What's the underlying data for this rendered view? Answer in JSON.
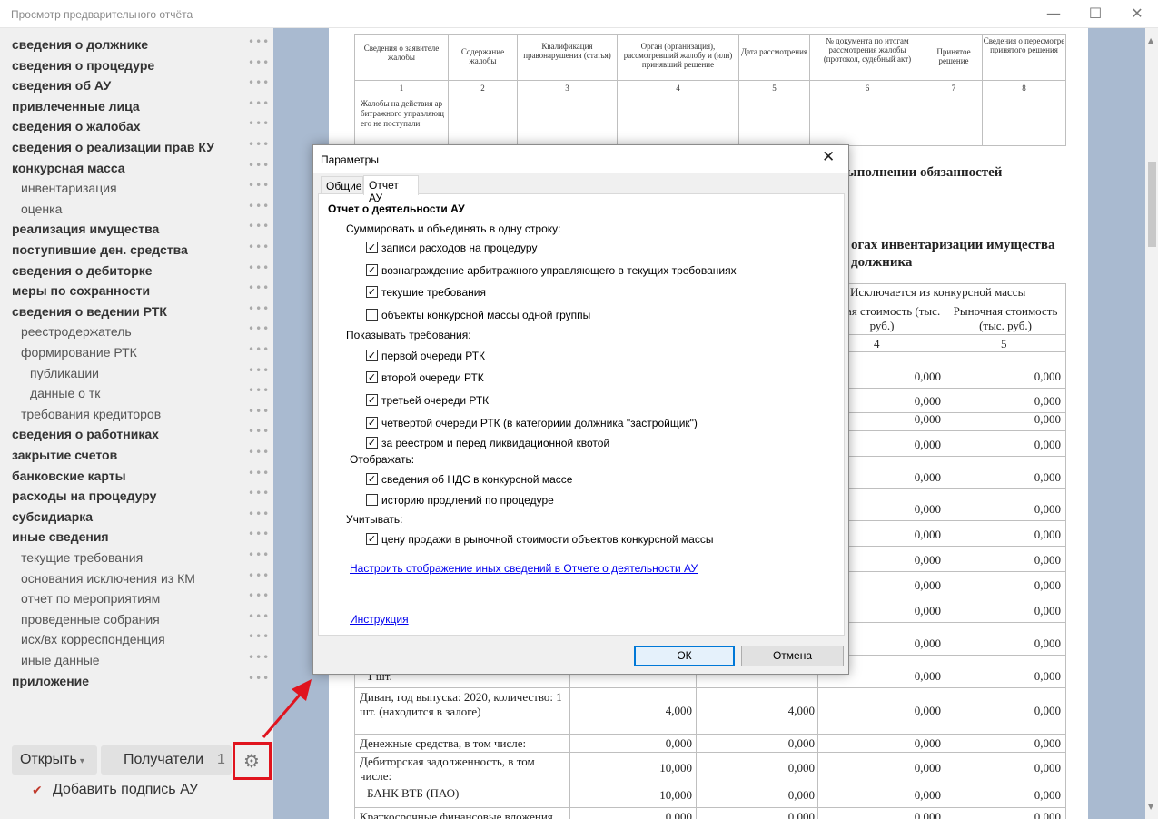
{
  "window": {
    "title": "Просмотр предварительного отчёта",
    "min_glyph": "—",
    "max_glyph": "☐",
    "close_glyph": "✕"
  },
  "sidebar": {
    "more_glyph": "•••",
    "items": [
      {
        "label": "сведения о должнике",
        "level": 0
      },
      {
        "label": "сведения о процедуре",
        "level": 0
      },
      {
        "label": "сведения об АУ",
        "level": 0
      },
      {
        "label": "привлеченные лица",
        "level": 0
      },
      {
        "label": "сведения о жалобах",
        "level": 0
      },
      {
        "label": "сведения о реализации прав КУ",
        "level": 0
      },
      {
        "label": "конкурсная масса",
        "level": 0
      },
      {
        "label": "инвентаризация",
        "level": 1
      },
      {
        "label": "оценка",
        "level": 1
      },
      {
        "label": "реализация имущества",
        "level": 0
      },
      {
        "label": "поступившие ден. средства",
        "level": 0
      },
      {
        "label": "сведения о дебиторке",
        "level": 0
      },
      {
        "label": "меры по сохранности",
        "level": 0
      },
      {
        "label": "сведения о ведении РТК",
        "level": 0
      },
      {
        "label": "реестродержатель",
        "level": 1
      },
      {
        "label": "формирование РТК",
        "level": 1
      },
      {
        "label": "публикации",
        "level": 2
      },
      {
        "label": "данные о тк",
        "level": 2
      },
      {
        "label": "требования кредиторов",
        "level": 1
      },
      {
        "label": "сведения о работниках",
        "level": 0
      },
      {
        "label": "закрытие счетов",
        "level": 0
      },
      {
        "label": "банковские карты",
        "level": 0
      },
      {
        "label": "расходы на процедуру",
        "level": 0
      },
      {
        "label": "субсидиарка",
        "level": 0
      },
      {
        "label": "иные сведения",
        "level": 0
      },
      {
        "label": "текущие требования",
        "level": 1
      },
      {
        "label": "основания исключения из КМ",
        "level": 1
      },
      {
        "label": "отчет по мероприятиям",
        "level": 1
      },
      {
        "label": "проведенные собрания",
        "level": 1
      },
      {
        "label": "исх/вх корреспонденция",
        "level": 1
      },
      {
        "label": "иные данные",
        "level": 1
      },
      {
        "label": "приложение",
        "level": 0
      }
    ],
    "open_button": "Открыть",
    "open_caret": "▾",
    "recipients_button": "Получатели",
    "recipients_count": "1",
    "gear_glyph": "⚙",
    "sign_checkbox": {
      "label": "Добавить подпись АУ",
      "checked": true,
      "glyph": "✔"
    }
  },
  "report": {
    "complaints_table": {
      "headers": [
        "Сведения о заявителе жалобы",
        "Содержание жалобы",
        "Квалификация правонарушения (статья)",
        "Орган (организация), рассмотревший жалобу и (или) принявший решение",
        "Дата рассмотрения",
        "№ документа по итогам рассмотрения жалобы (протокол, судебный акт)",
        "Принятое решение",
        "Сведения о пересмотре принятого решения"
      ],
      "col_numbers": [
        "1",
        "2",
        "3",
        "4",
        "5",
        "6",
        "7",
        "8"
      ],
      "row_text": "Жалобы на действия арбитражного управляющего не поступали"
    },
    "heading_1": "ыполнении обязанностей",
    "heading_2a": "огах инвентаризации имущества",
    "heading_2b": "должника",
    "inv_table": {
      "excluded_header": "Исключается из конкурсной массы",
      "book_value_header": "нсовая стоимость (тыс. руб.)",
      "market_value_header": "Рыночная стоимость (тыс. руб.)",
      "col4": "4",
      "col5": "5",
      "zero": "0,000",
      "fragment_text": "1 шт.",
      "rows": [
        {
          "name": "Диван, год выпуска: 2020, количество: 1 шт. (находится в залоге)",
          "c2": "4,000",
          "c3": "4,000",
          "c4": "0,000",
          "c5": "0,000"
        },
        {
          "name": "Денежные средства, в том числе:",
          "c2": "0,000",
          "c3": "0,000",
          "c4": "0,000",
          "c5": "0,000"
        },
        {
          "name": "Дебиторская задолженность, в том числе:",
          "c2": "10,000",
          "c3": "0,000",
          "c4": "0,000",
          "c5": "0,000"
        },
        {
          "name": "БАНК ВТБ (ПАО)",
          "c2": "10,000",
          "c3": "0,000",
          "c4": "0,000",
          "c5": "0,000"
        },
        {
          "name": "Краткосрочные финансовые вложения,",
          "c2": "0,000",
          "c3": "0,000",
          "c4": "0,000",
          "c5": "0,000"
        }
      ]
    },
    "nav_up_glyph": "⌃",
    "nav_down_glyph": "⌄",
    "scroll_up_glyph": "▲",
    "scroll_down_glyph": "▼"
  },
  "dialog": {
    "title": "Параметры",
    "close_glyph": "✕",
    "tabs": [
      {
        "label": "Общие",
        "active": false
      },
      {
        "label": "Отчет АУ",
        "active": true
      }
    ],
    "section_title": "Отчет о деятельности АУ",
    "check_glyph": "✓",
    "groups": {
      "summarize": "Суммировать и объединять в одну строку:",
      "show_requirements": "Показывать требования:",
      "display": "Отображать:",
      "account": "Учитывать:"
    },
    "checkboxes": [
      {
        "label": "записи расходов на процедуру",
        "checked": true
      },
      {
        "label": "вознаграждение арбитражного управляющего в текущих требованиях",
        "checked": true
      },
      {
        "label": "текущие требования",
        "checked": true
      },
      {
        "label": "объекты конкурсной массы одной группы",
        "checked": false
      },
      {
        "label": "первой очереди РТК",
        "checked": true
      },
      {
        "label": "второй очереди РТК",
        "checked": true
      },
      {
        "label": " третьей очереди РТК",
        "checked": true
      },
      {
        "label": "четвертой очереди РТК (в категориии должника \"застройщик\")",
        "checked": true
      },
      {
        "label": "за реестром и перед ликвидационной квотой",
        "checked": true
      },
      {
        "label": "сведения об НДС в конкурсной массе",
        "checked": true
      },
      {
        "label": "историю продлений по процедуре",
        "checked": false
      },
      {
        "label": "цену продажи в рыночной стоимости объектов конкурсной массы",
        "checked": true
      }
    ],
    "link_configure": "Настроить отображение иных сведений в Отчете о деятельности АУ",
    "link_instruction": "Инструкция",
    "ok_button": "ОК",
    "cancel_button": "Отмена"
  },
  "colors": {
    "accent_red": "#e0141e",
    "dialog_focus": "#0078d7",
    "report_bg": "#a9bad0"
  }
}
